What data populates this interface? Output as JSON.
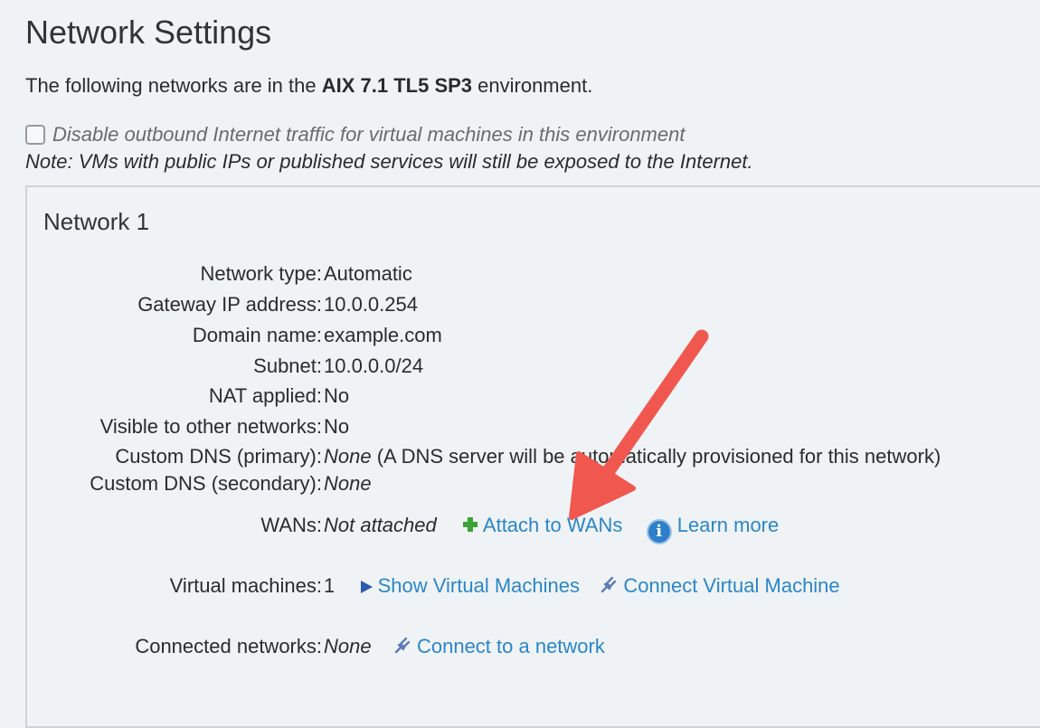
{
  "page": {
    "title": "Network Settings",
    "intro_prefix": "The following networks are in the ",
    "environment_name": "AIX 7.1 TL5 SP3",
    "intro_suffix": " environment.",
    "disable_outbound_label": "Disable outbound Internet traffic for virtual machines in this environment",
    "disable_outbound_checked": false,
    "note": "Note: VMs with public IPs or published services will still be exposed to the Internet."
  },
  "network": {
    "title": "Network 1",
    "properties": [
      {
        "label": "Network type:",
        "value": "Automatic"
      },
      {
        "label": "Gateway IP address:",
        "value": "10.0.0.254"
      },
      {
        "label": "Domain name:",
        "value": "example.com"
      },
      {
        "label": "Subnet:",
        "value": "10.0.0.0/24"
      },
      {
        "label": "NAT applied:",
        "value": "No"
      },
      {
        "label": "Visible to other networks:",
        "value": "No"
      }
    ],
    "dns_primary": {
      "label": "Custom DNS (primary):",
      "value": "None",
      "note": " (A DNS server will be automatically provisioned for this network)"
    },
    "dns_secondary": {
      "label": "Custom DNS (secondary):",
      "value": "None"
    },
    "wans": {
      "label": "WANs:",
      "value": "Not attached",
      "attach_label": "Attach to WANs",
      "learn_more_label": "Learn more",
      "info_glyph": "i"
    },
    "virtual_machines": {
      "label": "Virtual machines:",
      "count": "1",
      "show_label": "Show Virtual Machines",
      "connect_label": "Connect Virtual Machine"
    },
    "connected_networks": {
      "label": "Connected networks:",
      "value": "None",
      "connect_label": "Connect to a network"
    }
  },
  "colors": {
    "background": "#f0f3f6",
    "link": "#2a86c8",
    "plus": "#3aa535",
    "annotation_arrow": "#f0584f"
  },
  "icons": {
    "checkbox": "checkbox-icon",
    "plus": "plus-icon",
    "info": "info-icon",
    "play": "play-icon",
    "connect": "connect-icon",
    "annotation": "red-arrow-annotation"
  }
}
